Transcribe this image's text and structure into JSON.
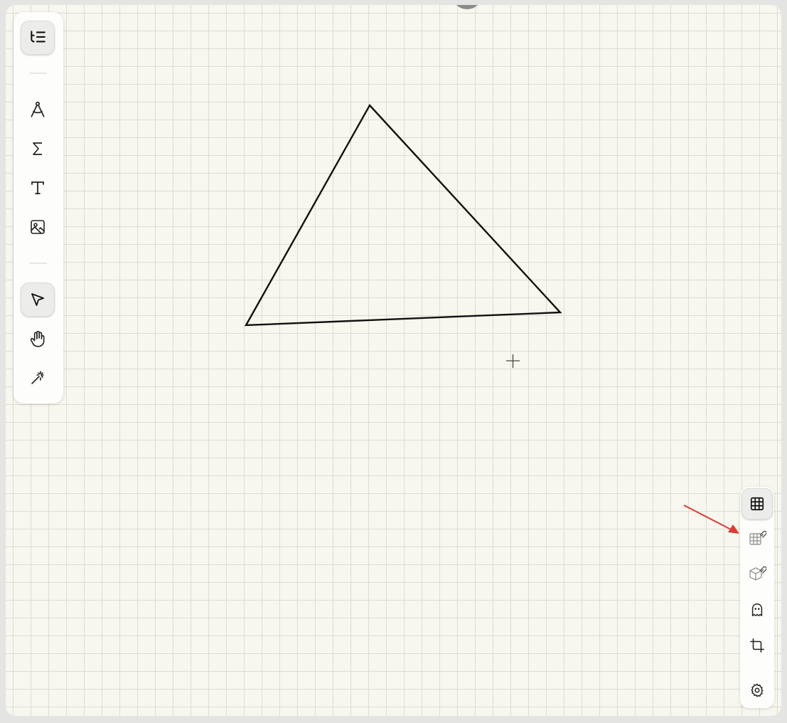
{
  "left_toolbar": {
    "tools": [
      {
        "id": "outline",
        "icon": "outline-list-icon",
        "active": true
      },
      {
        "id": "compass",
        "icon": "compass-icon",
        "active": false
      },
      {
        "id": "formula",
        "icon": "sigma-icon",
        "active": false
      },
      {
        "id": "text",
        "icon": "text-icon",
        "active": false
      },
      {
        "id": "image",
        "icon": "image-icon",
        "active": false
      },
      {
        "id": "select",
        "icon": "pointer-arrow-icon",
        "active": true
      },
      {
        "id": "pan",
        "icon": "hand-icon",
        "active": false
      },
      {
        "id": "magic",
        "icon": "magic-wand-icon",
        "active": false
      }
    ]
  },
  "right_toolbar": {
    "tools": [
      {
        "id": "grid",
        "icon": "grid-icon",
        "active": true
      },
      {
        "id": "grid-snap",
        "icon": "grid-magnet-icon",
        "active": false
      },
      {
        "id": "cube-snap",
        "icon": "cube-magnet-icon",
        "active": false
      },
      {
        "id": "ghost",
        "icon": "ghost-icon",
        "active": false
      },
      {
        "id": "crop",
        "icon": "crop-icon",
        "active": false
      },
      {
        "id": "settings",
        "icon": "gear-icon",
        "active": false
      }
    ]
  },
  "canvas": {
    "background_color": "#f8f7ef",
    "grid_color": "#dddcd3",
    "shape": {
      "type": "triangle",
      "stroke_color": "#111111"
    }
  },
  "annotation": {
    "type": "arrow",
    "color": "#e03a32",
    "points_to": "grid-snap"
  }
}
